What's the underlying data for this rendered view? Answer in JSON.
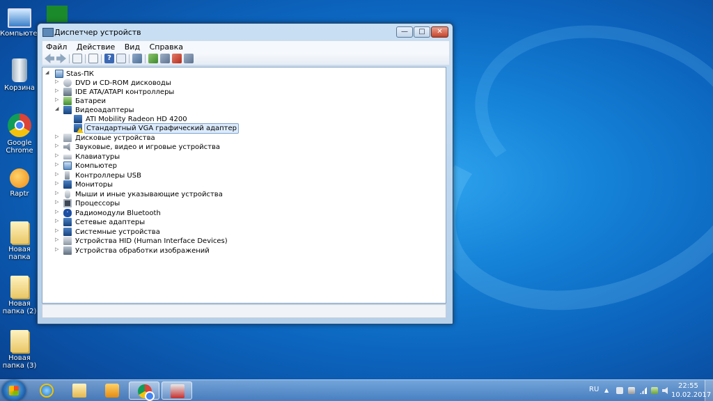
{
  "desktop": {
    "icons": [
      {
        "label": "Компьютер",
        "icon": "computer-icon"
      },
      {
        "label": "Корзина",
        "icon": "recycle-bin-icon"
      },
      {
        "label": "Google Chrome",
        "icon": "chrome-icon"
      },
      {
        "label": "Raptr",
        "icon": "raptr-icon"
      },
      {
        "label": "Новая папка",
        "icon": "folder-icon"
      },
      {
        "label": "Новая папка (2)",
        "icon": "folder-icon"
      },
      {
        "label": "Новая папка (3)",
        "icon": "folder-icon"
      }
    ]
  },
  "window": {
    "title": "Диспетчер устройств",
    "menu": [
      "Файл",
      "Действие",
      "Вид",
      "Справка"
    ],
    "tree": {
      "root": "Stas-ПК",
      "items": [
        {
          "label": "DVD и CD-ROM дисководы",
          "icon": "dvd-drive-icon",
          "expanded": false
        },
        {
          "label": "IDE ATA/ATAPI контроллеры",
          "icon": "ide-controller-icon",
          "expanded": false
        },
        {
          "label": "Батареи",
          "icon": "battery-icon",
          "expanded": false
        },
        {
          "label": "Видеоадаптеры",
          "icon": "display-adapter-icon",
          "expanded": true,
          "children": [
            {
              "label": "ATI Mobility Radeon HD 4200",
              "icon": "display-adapter-icon",
              "warning": false
            },
            {
              "label": "Стандартный VGA графический адаптер",
              "icon": "display-adapter-warning-icon",
              "warning": true,
              "selected": true
            }
          ]
        },
        {
          "label": "Дисковые устройства",
          "icon": "disk-drive-icon",
          "expanded": false
        },
        {
          "label": "Звуковые, видео и игровые устройства",
          "icon": "sound-icon",
          "expanded": false
        },
        {
          "label": "Клавиатуры",
          "icon": "keyboard-icon",
          "expanded": false
        },
        {
          "label": "Компьютер",
          "icon": "computer-icon",
          "expanded": false
        },
        {
          "label": "Контроллеры USB",
          "icon": "usb-icon",
          "expanded": false
        },
        {
          "label": "Мониторы",
          "icon": "monitor-icon",
          "expanded": false
        },
        {
          "label": "Мыши и иные указывающие устройства",
          "icon": "mouse-icon",
          "expanded": false
        },
        {
          "label": "Процессоры",
          "icon": "processor-icon",
          "expanded": false
        },
        {
          "label": "Радиомодули Bluetooth",
          "icon": "bluetooth-icon",
          "expanded": false
        },
        {
          "label": "Сетевые адаптеры",
          "icon": "network-adapter-icon",
          "expanded": false
        },
        {
          "label": "Системные устройства",
          "icon": "system-devices-icon",
          "expanded": false
        },
        {
          "label": "Устройства HID (Human Interface Devices)",
          "icon": "hid-icon",
          "expanded": false
        },
        {
          "label": "Устройства обработки изображений",
          "icon": "imaging-device-icon",
          "expanded": false
        }
      ]
    }
  },
  "taskbar": {
    "language": "RU",
    "time": "22:55",
    "date": "10.02.2017",
    "pinned": [
      "internet-explorer-icon",
      "explorer-folder-icon",
      "media-player-icon",
      "chrome-icon",
      "device-manager-icon"
    ]
  }
}
